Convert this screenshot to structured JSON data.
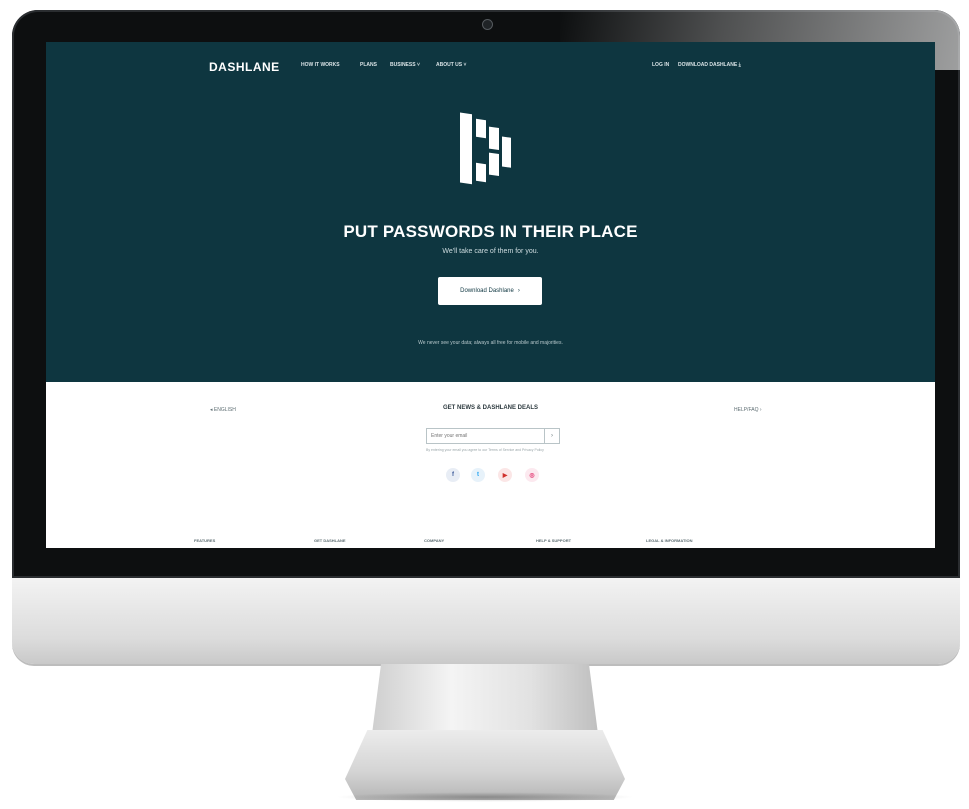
{
  "site": {
    "brand": "DASHLANE",
    "nav": [
      "HOW IT WORKS",
      "PLANS",
      "BUSINESS",
      "ABOUT US"
    ],
    "nav_right": {
      "login": "LOG IN",
      "download": "DOWNLOAD DASHLANE"
    }
  },
  "hero": {
    "headline": "PUT PASSWORDS IN THEIR PLACE",
    "subline": "We'll take care of them for you.",
    "cta_label": "Download Dashlane",
    "fine_note": "We never see your data; always all free for mobile and majorities."
  },
  "lower": {
    "language": "ENGLISH",
    "deals_title": "GET NEWS & DASHLANE DEALS",
    "help": "HELP/FAQ",
    "email_placeholder": "Enter your email",
    "email_submit": "›",
    "terms": "By entering your email you agree to our Terms of Service and Privacy Policy",
    "social": [
      "f",
      "t",
      "▶",
      "◎"
    ]
  },
  "footer_columns": [
    "FEATURES",
    "GET DASHLANE",
    "COMPANY",
    "HELP & SUPPORT",
    "LEGAL & INFORMATION"
  ],
  "colors": {
    "hero_bg": "#0e3640",
    "text_on_dark": "#ffffff"
  }
}
